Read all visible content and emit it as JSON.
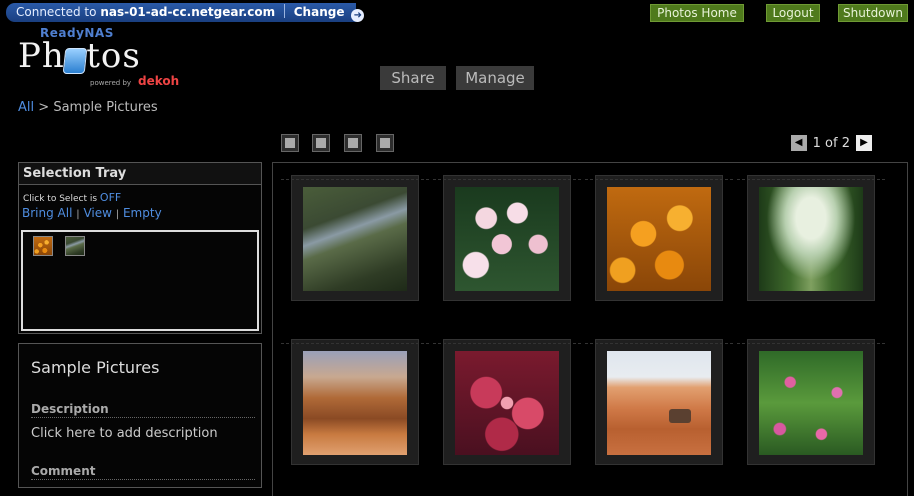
{
  "topbar": {
    "connected_prefix": "Connected to",
    "host": "nas-01-ad-cc.netgear.com",
    "change_label": "Change",
    "buttons": [
      "Photos Home",
      "Logout",
      "Shutdown"
    ]
  },
  "logo": {
    "brand": "ReadyNAS",
    "product": "Photos",
    "powered_by": "powered by",
    "vendor": "dekoh"
  },
  "tabs": [
    "Share",
    "Manage"
  ],
  "breadcrumb": {
    "root": "All",
    "separator": ">",
    "current": "Sample Pictures"
  },
  "pager": {
    "text": "1 of 2"
  },
  "selection_tray": {
    "title": "Selection Tray",
    "click_to_select_label": "Click to Select is",
    "click_to_select_state": "OFF",
    "links": [
      "Bring All",
      "View",
      "Empty"
    ]
  },
  "album_info": {
    "name": "Sample Pictures",
    "description_label": "Description",
    "description_placeholder": "Click here to add description",
    "comment_label": "Comment"
  },
  "gallery": {
    "photos": [
      "stream",
      "plumeria",
      "orange-flowers",
      "forest-path",
      "desert-mesa",
      "frosted-leaves",
      "dunes-oryx",
      "green-leaves-pink-flowers"
    ]
  },
  "colors": {
    "accent_blue": "#4f8de0",
    "button_green": "#4f7a1c",
    "connection_bar": "#2a5aa8"
  }
}
